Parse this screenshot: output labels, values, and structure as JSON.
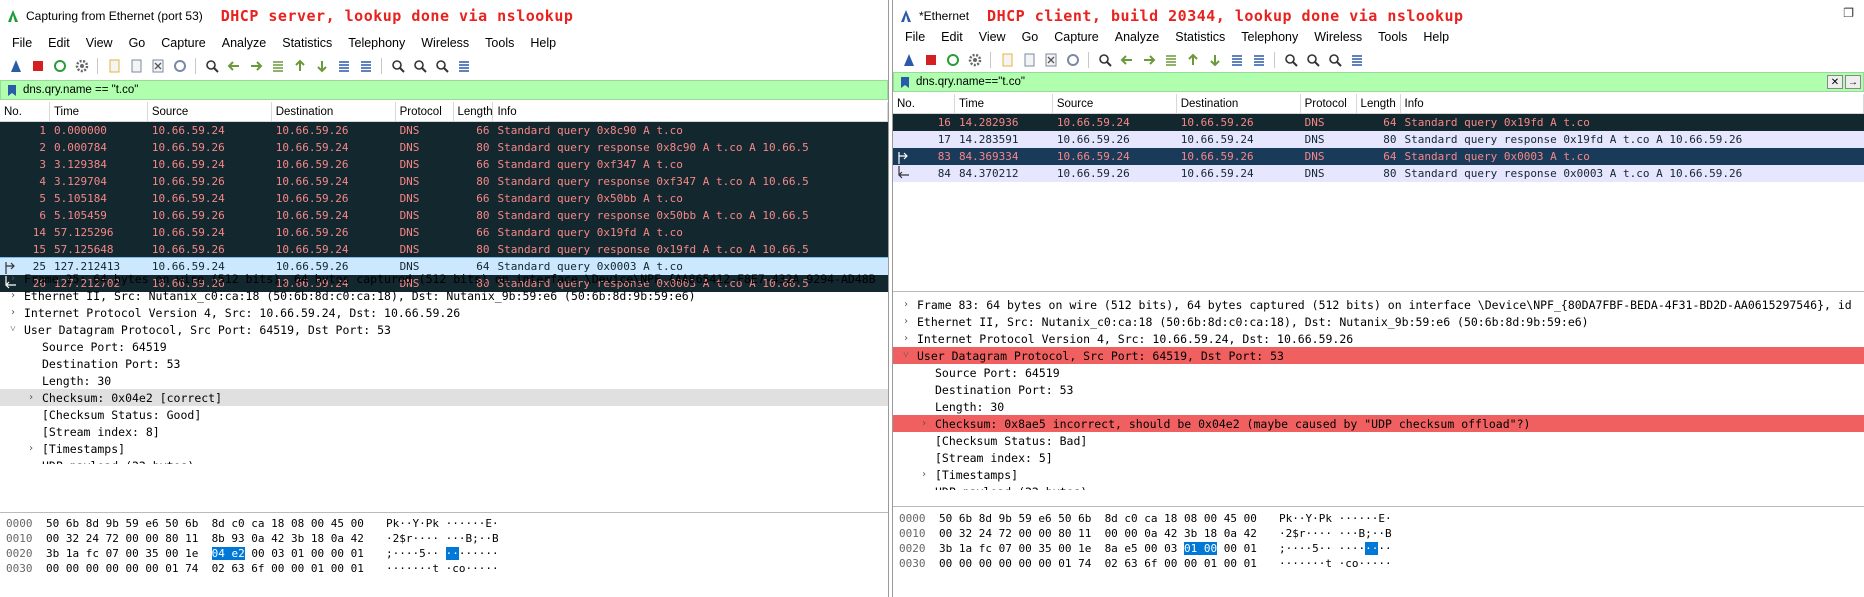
{
  "left": {
    "title": "Capturing from Ethernet (port 53)",
    "annotation": "DHCP server, lookup done via nslookup",
    "menu": [
      "File",
      "Edit",
      "View",
      "Go",
      "Capture",
      "Analyze",
      "Statistics",
      "Telephony",
      "Wireless",
      "Tools",
      "Help"
    ],
    "filter": "dns.qry.name == \"t.co\"",
    "columns": [
      "No.",
      "Time",
      "Source",
      "Destination",
      "Protocol",
      "Length",
      "Info"
    ],
    "packets": [
      {
        "no": "1",
        "time": "0.000000",
        "src": "10.66.59.24",
        "dst": "10.66.59.26",
        "proto": "DNS",
        "len": "66",
        "info": "Standard query 0x8c90 A t.co",
        "style": "dark"
      },
      {
        "no": "2",
        "time": "0.000784",
        "src": "10.66.59.26",
        "dst": "10.66.59.24",
        "proto": "DNS",
        "len": "80",
        "info": "Standard query response 0x8c90 A t.co A 10.66.5",
        "style": "dark"
      },
      {
        "no": "3",
        "time": "3.129384",
        "src": "10.66.59.24",
        "dst": "10.66.59.26",
        "proto": "DNS",
        "len": "66",
        "info": "Standard query 0xf347 A t.co",
        "style": "dark"
      },
      {
        "no": "4",
        "time": "3.129704",
        "src": "10.66.59.26",
        "dst": "10.66.59.24",
        "proto": "DNS",
        "len": "80",
        "info": "Standard query response 0xf347 A t.co A 10.66.5",
        "style": "dark"
      },
      {
        "no": "5",
        "time": "5.105184",
        "src": "10.66.59.24",
        "dst": "10.66.59.26",
        "proto": "DNS",
        "len": "66",
        "info": "Standard query 0x50bb A t.co",
        "style": "dark"
      },
      {
        "no": "6",
        "time": "5.105459",
        "src": "10.66.59.26",
        "dst": "10.66.59.24",
        "proto": "DNS",
        "len": "80",
        "info": "Standard query response 0x50bb A t.co A 10.66.5",
        "style": "dark"
      },
      {
        "no": "14",
        "time": "57.125296",
        "src": "10.66.59.24",
        "dst": "10.66.59.26",
        "proto": "DNS",
        "len": "66",
        "info": "Standard query 0x19fd A t.co",
        "style": "dark"
      },
      {
        "no": "15",
        "time": "57.125648",
        "src": "10.66.59.26",
        "dst": "10.66.59.24",
        "proto": "DNS",
        "len": "80",
        "info": "Standard query response 0x19fd A t.co A 10.66.5",
        "style": "dark"
      },
      {
        "no": "25",
        "time": "127.212413",
        "src": "10.66.59.24",
        "dst": "10.66.59.26",
        "proto": "DNS",
        "len": "64",
        "info": "Standard query 0x0003 A t.co",
        "style": "selected"
      },
      {
        "no": "26",
        "time": "127.212702",
        "src": "10.66.59.26",
        "dst": "10.66.59.24",
        "proto": "DNS",
        "len": "80",
        "info": "Standard query response 0x0003 A t.co A 10.66.5",
        "style": "dark"
      }
    ],
    "details": [
      {
        "text": "Frame 25: 64 bytes on wire (512 bits), 64 bytes captured (512 bits) on interface \\Device\\NPF_{AA865412-F8E7-432A-9294-AD48B",
        "arrow": ">",
        "indent": 0,
        "style": ""
      },
      {
        "text": "Ethernet II, Src: Nutanix_c0:ca:18 (50:6b:8d:c0:ca:18), Dst: Nutanix_9b:59:e6 (50:6b:8d:9b:59:e6)",
        "arrow": ">",
        "indent": 0,
        "style": ""
      },
      {
        "text": "Internet Protocol Version 4, Src: 10.66.59.24, Dst: 10.66.59.26",
        "arrow": ">",
        "indent": 0,
        "style": ""
      },
      {
        "text": "User Datagram Protocol, Src Port: 64519, Dst Port: 53",
        "arrow": "v",
        "indent": 0,
        "style": ""
      },
      {
        "text": "Source Port: 64519",
        "arrow": "",
        "indent": 1,
        "style": ""
      },
      {
        "text": "Destination Port: 53",
        "arrow": "",
        "indent": 1,
        "style": ""
      },
      {
        "text": "Length: 30",
        "arrow": "",
        "indent": 1,
        "style": ""
      },
      {
        "text": "Checksum: 0x04e2 [correct]",
        "arrow": ">",
        "indent": 1,
        "style": "hl"
      },
      {
        "text": "[Checksum Status: Good]",
        "arrow": "",
        "indent": 1,
        "style": ""
      },
      {
        "text": "[Stream index: 8]",
        "arrow": "",
        "indent": 1,
        "style": ""
      },
      {
        "text": "[Timestamps]",
        "arrow": ">",
        "indent": 1,
        "style": ""
      },
      {
        "text": "UDP payload (22 bytes)",
        "arrow": "",
        "indent": 1,
        "style": ""
      }
    ],
    "bytes": [
      {
        "off": "0000",
        "hex": [
          "50 6b 8d 9b 59 e6 50 6b  8d c0 ca 18 08 00 45 00"
        ],
        "asc": "Pk··Y·Pk ······E·"
      },
      {
        "off": "0010",
        "hex": [
          "00 32 24 72 00 00 80 11  8b 93 0a 42 3b 18 0a 42"
        ],
        "asc": "·2$r···· ···B;··B"
      },
      {
        "off": "0020",
        "hex": [
          "3b 1a fc 07 00 35 00 1e  ",
          "04 e2",
          " 00 03 01 00 00 01"
        ],
        "asc_parts": [
          ";····5·· ",
          "··",
          "······"
        ]
      },
      {
        "off": "0030",
        "hex": [
          "00 00 00 00 00 00 01 74  02 63 6f 00 00 01 00 01"
        ],
        "asc": "·······t ·co·····"
      }
    ]
  },
  "right": {
    "title": "*Ethernet",
    "annotation": "DHCP client, build 20344, lookup done via nslookup",
    "menu": [
      "File",
      "Edit",
      "View",
      "Go",
      "Capture",
      "Analyze",
      "Statistics",
      "Telephony",
      "Wireless",
      "Tools",
      "Help"
    ],
    "filter": "dns.qry.name==\"t.co\"",
    "columns": [
      "No.",
      "Time",
      "Source",
      "Destination",
      "Protocol",
      "Length",
      "Info"
    ],
    "packets": [
      {
        "no": "16",
        "time": "14.282936",
        "src": "10.66.59.24",
        "dst": "10.66.59.26",
        "proto": "DNS",
        "len": "64",
        "info": "Standard query 0x19fd A t.co",
        "style": "dark"
      },
      {
        "no": "17",
        "time": "14.283591",
        "src": "10.66.59.26",
        "dst": "10.66.59.24",
        "proto": "DNS",
        "len": "80",
        "info": "Standard query response 0x19fd A t.co A 10.66.59.26",
        "style": "light"
      },
      {
        "no": "83",
        "time": "84.369334",
        "src": "10.66.59.24",
        "dst": "10.66.59.26",
        "proto": "DNS",
        "len": "64",
        "info": "Standard query 0x0003 A t.co",
        "style": "sel-dark"
      },
      {
        "no": "84",
        "time": "84.370212",
        "src": "10.66.59.26",
        "dst": "10.66.59.24",
        "proto": "DNS",
        "len": "80",
        "info": "Standard query response 0x0003 A t.co A 10.66.59.26",
        "style": "light"
      }
    ],
    "details": [
      {
        "text": "Frame 83: 64 bytes on wire (512 bits), 64 bytes captured (512 bits) on interface \\Device\\NPF_{80DA7FBF-BEDA-4F31-BD2D-AA0615297546}, id",
        "arrow": ">",
        "indent": 0,
        "style": ""
      },
      {
        "text": "Ethernet II, Src: Nutanix_c0:ca:18 (50:6b:8d:c0:ca:18), Dst: Nutanix_9b:59:e6 (50:6b:8d:9b:59:e6)",
        "arrow": ">",
        "indent": 0,
        "style": ""
      },
      {
        "text": "Internet Protocol Version 4, Src: 10.66.59.24, Dst: 10.66.59.26",
        "arrow": ">",
        "indent": 0,
        "style": ""
      },
      {
        "text": "User Datagram Protocol, Src Port: 64519, Dst Port: 53",
        "arrow": "v",
        "indent": 0,
        "style": "err"
      },
      {
        "text": "Source Port: 64519",
        "arrow": "",
        "indent": 1,
        "style": ""
      },
      {
        "text": "Destination Port: 53",
        "arrow": "",
        "indent": 1,
        "style": ""
      },
      {
        "text": "Length: 30",
        "arrow": "",
        "indent": 1,
        "style": ""
      },
      {
        "text": "Checksum: 0x8ae5 incorrect, should be 0x04e2 (maybe caused by \"UDP checksum offload\"?)",
        "arrow": ">",
        "indent": 1,
        "style": "err"
      },
      {
        "text": "[Checksum Status: Bad]",
        "arrow": "",
        "indent": 1,
        "style": ""
      },
      {
        "text": "[Stream index: 5]",
        "arrow": "",
        "indent": 1,
        "style": ""
      },
      {
        "text": "[Timestamps]",
        "arrow": ">",
        "indent": 1,
        "style": ""
      },
      {
        "text": "UDP payload (22 bytes)",
        "arrow": "",
        "indent": 1,
        "style": ""
      }
    ],
    "bytes": [
      {
        "off": "0000",
        "hex": [
          "50 6b 8d 9b 59 e6 50 6b  8d c0 ca 18 08 00 45 00"
        ],
        "asc": "Pk··Y·Pk ······E·"
      },
      {
        "off": "0010",
        "hex": [
          "00 32 24 72 00 00 80 11  00 00 0a 42 3b 18 0a 42"
        ],
        "asc": "·2$r···· ···B;··B"
      },
      {
        "off": "0020",
        "hex": [
          "3b 1a fc 07 00 35 00 1e  8a e5 00 03 ",
          "01 00",
          " 00 01"
        ],
        "asc_parts": [
          ";····5·· ····",
          "··",
          "··"
        ]
      },
      {
        "off": "0030",
        "hex": [
          "00 00 00 00 00 00 01 74  02 63 6f 00 00 01 00 01"
        ],
        "asc": "·······t ·co·····"
      }
    ]
  },
  "colors": {
    "row_dark_bg": "#12272e",
    "row_dark_fg": "#f78787",
    "row_light_bg": "#e7e6ff",
    "filter_bg": "#afffaf",
    "error_bg": "#f06060",
    "selection_blue": "#0078d7",
    "annotation_red": "#e8221e"
  }
}
